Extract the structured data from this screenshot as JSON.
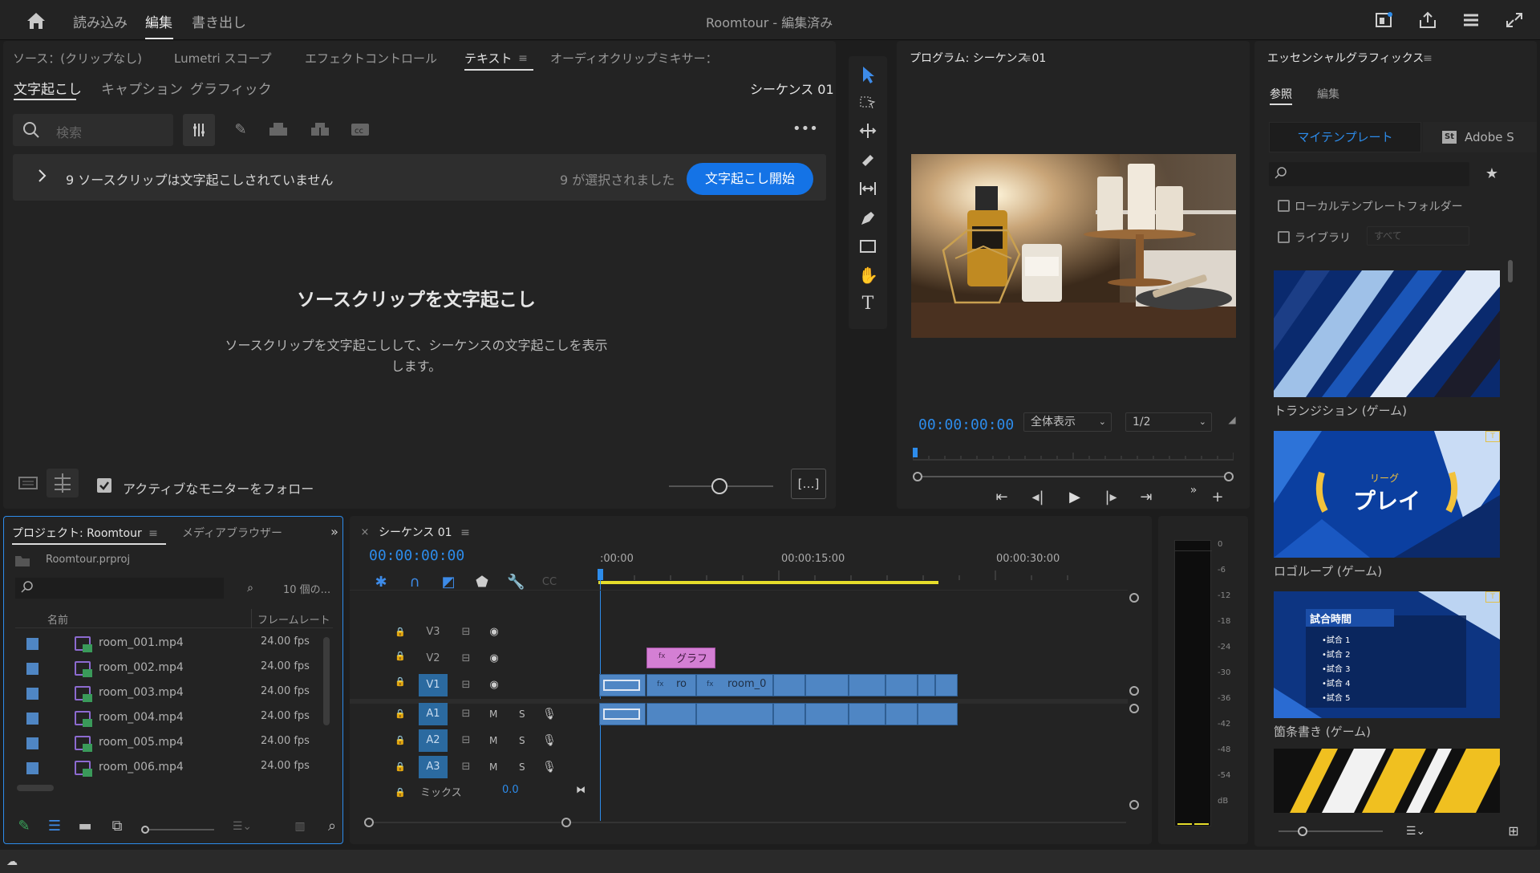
{
  "app": {
    "title": "Roomtour",
    "title_suffix": " - 編集済み",
    "nav": [
      "読み込み",
      "編集",
      "書き出し"
    ]
  },
  "source_tabs": [
    "ソース：(クリップなし)",
    "Lumetri スコープ",
    "エフェクトコントロール",
    "テキスト",
    "オーディオクリップミキサー："
  ],
  "text_panel": {
    "subtabs": [
      "文字起こし",
      "キャプション",
      "グラフィック"
    ],
    "sequence_label": "シーケンス 01",
    "search_placeholder": "検索",
    "banner_text": "9 ソースクリップは文字起こしされていません",
    "selected_text": "9 が選択されました",
    "start_button": "文字起こし開始",
    "empty_title": "ソースクリップを文字起こし",
    "empty_desc_1": "ソースクリップを文字起こしして、シーケンスの文字起こしを表示",
    "empty_desc_2": "します。",
    "follow_label": "アクティブなモニターをフォロー",
    "more_btn": "[…]"
  },
  "program": {
    "title": "プログラム: シーケンス 01",
    "timecode": "00:00:00:00",
    "fit": "全体表示",
    "resolution": "1/2"
  },
  "essential": {
    "title": "エッセンシャルグラフィックス",
    "tabs": [
      "参照",
      "編集"
    ],
    "my_templates": "マイテンプレート",
    "adobe_stock": "Adobe S",
    "local_folder": "ローカルテンプレートフォルダー",
    "library": "ライブラリ",
    "library_select": "すべて",
    "templates": [
      "トランジション (ゲーム)",
      "ロゴループ (ゲーム)",
      "箇条書き (ゲーム)"
    ],
    "logo_text_small": "リーグ",
    "logo_text": "プレイ",
    "bullet_title": "試合時間",
    "bullets": [
      "•試合 1",
      "•試合 2",
      "•試合 3",
      "•試合 4",
      "•試合 5"
    ]
  },
  "project": {
    "tabs": [
      "プロジェクト: Roomtour",
      "メディアブラウザー"
    ],
    "file": "Roomtour.prproj",
    "count": "10 個の...",
    "col_name": "名前",
    "col_fps": "フレームレート",
    "items": [
      {
        "name": "room_001.mp4",
        "fps": "24.00 fps"
      },
      {
        "name": "room_002.mp4",
        "fps": "24.00 fps"
      },
      {
        "name": "room_003.mp4",
        "fps": "24.00 fps"
      },
      {
        "name": "room_004.mp4",
        "fps": "24.00 fps"
      },
      {
        "name": "room_005.mp4",
        "fps": "24.00 fps"
      },
      {
        "name": "room_006.mp4",
        "fps": "24.00 fps"
      }
    ]
  },
  "timeline": {
    "title": "シーケンス 01",
    "timecode": "00:00:00:00",
    "ruler": [
      ":00:00",
      "00:00:15:00",
      "00:00:30:00"
    ],
    "video_tracks": [
      "V3",
      "V2",
      "V1"
    ],
    "audio_tracks": [
      "A1",
      "A2",
      "A3"
    ],
    "mix_label": "ミックス",
    "mix_value": "0.0",
    "graphic_clip": "グラフ",
    "clip_a": "ro",
    "clip_b": "room_0",
    "m": "M",
    "s": "S"
  },
  "meter": {
    "labels": [
      "0",
      "-6",
      "-12",
      "-18",
      "-24",
      "-30",
      "-36",
      "-42",
      "-48",
      "-54",
      "dB"
    ]
  },
  "colors": {
    "accent": "#1473e6",
    "timecode": "#2d8ceb",
    "clip": "#4f86c4",
    "graphic": "#d47fd4",
    "playbar": "#e6dd2b"
  }
}
